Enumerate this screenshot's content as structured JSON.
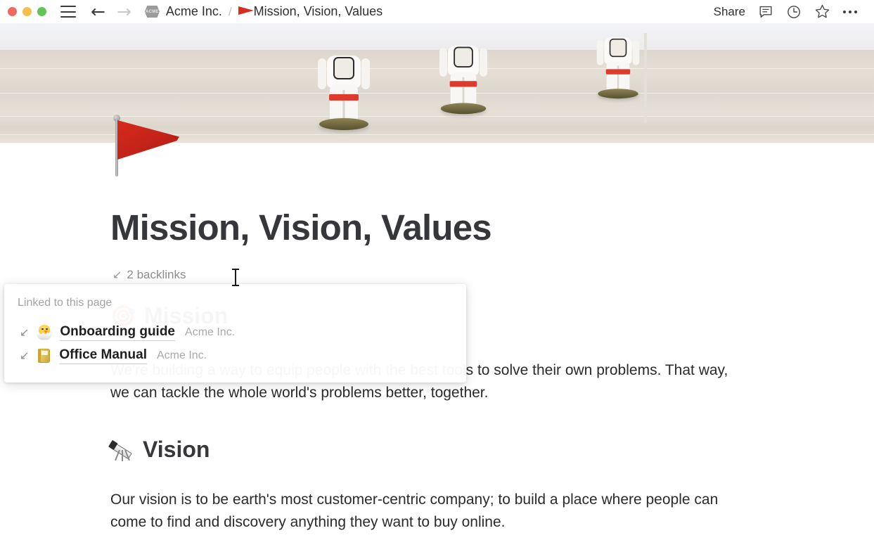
{
  "window": {
    "traffic_lights": [
      {
        "name": "close",
        "color": "#ED6A5E"
      },
      {
        "name": "minimize",
        "color": "#F5BF4F"
      },
      {
        "name": "maximize",
        "color": "#61C454"
      }
    ]
  },
  "titlebar": {
    "menu_icon": "hamburger-menu-icon",
    "back_icon": "←",
    "forward_icon": "→",
    "breadcrumb": {
      "workspace_logo_text": "ACME",
      "workspace": "Acme Inc.",
      "separator": "/",
      "page_icon": "red-flag",
      "page": "Mission, Vision, Values"
    },
    "share_label": "Share",
    "comment_icon": "comment-icon",
    "history_icon": "clock-history-icon",
    "favorite_icon": "star-icon",
    "more_icon": "more-options-icon"
  },
  "cover": {
    "alt": "astronaut figurines on a light wooden surface"
  },
  "page": {
    "icon": "red-flag-emoji",
    "title": "Mission, Vision, Values",
    "backlinks_arrow": "↙",
    "backlinks_label": "2 backlinks"
  },
  "sections": [
    {
      "emoji": "mission-emoji",
      "heading": "Mission",
      "body": "We're building a way to equip people with the best tools to solve their own problems. That way, we can tackle the whole world's problems better, together."
    },
    {
      "emoji": "telescope-emoji",
      "heading": "Vision",
      "body": "Our vision is to be earth's most customer-centric company; to build a place where people can come to find and discovery anything they want to buy online."
    }
  ],
  "backlinks_popup": {
    "header": "Linked to this page",
    "items": [
      {
        "arrow": "↙",
        "emoji": "hatching-chick-emoji",
        "title": "Onboarding guide",
        "parent": "Acme Inc."
      },
      {
        "arrow": "↙",
        "emoji": "ledger-book-emoji",
        "title": "Office Manual",
        "parent": "Acme Inc."
      }
    ]
  },
  "colors": {
    "flag_red": "#d8291c",
    "text_primary": "#2b2b2b",
    "text_muted": "#8d8d8d"
  }
}
